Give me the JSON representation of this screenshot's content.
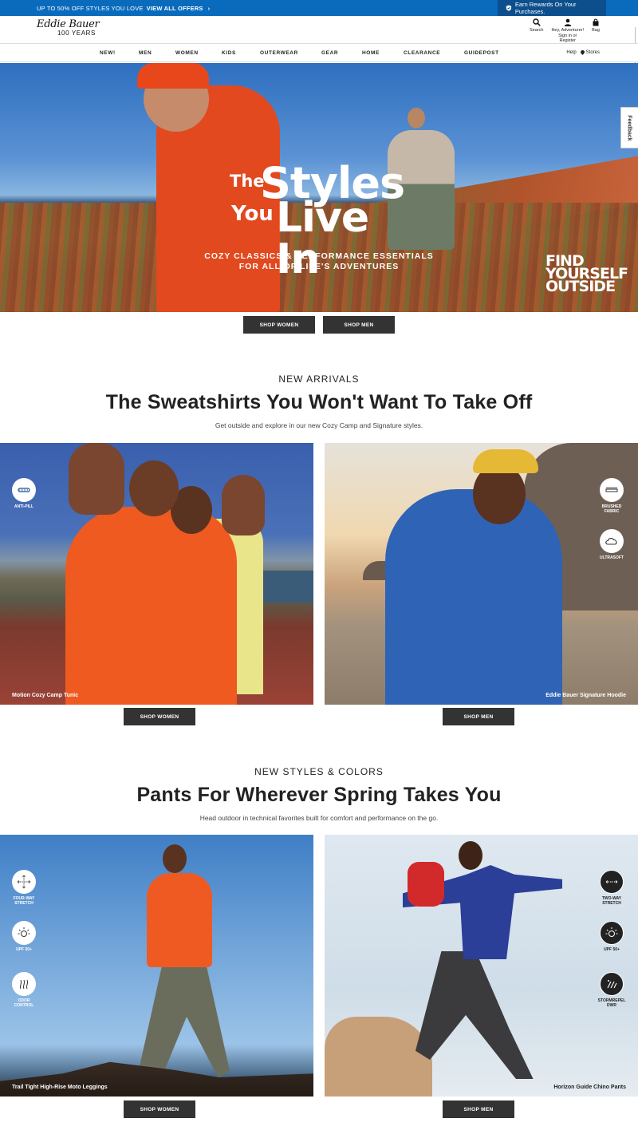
{
  "promo": {
    "text": "UP TO 50% OFF STYLES YOU LOVE",
    "link": "VIEW ALL OFFERS",
    "rewards": "Earn Rewards On Your Purchases."
  },
  "header": {
    "logo_script": "Eddie Bauer",
    "logo_years": "100 YEARS",
    "search": "Search",
    "account_line1": "Hey, Adventurer!",
    "account_line2": "Sign in or",
    "account_line3": "Register",
    "bag": "Bag"
  },
  "nav": {
    "items": [
      "NEW!",
      "MEN",
      "WOMEN",
      "KIDS",
      "OUTERWEAR",
      "GEAR",
      "HOME",
      "CLEARANCE",
      "GUIDEPOST"
    ],
    "help": "Help",
    "stores": "Stores"
  },
  "hero": {
    "title_the": "The",
    "title_styles": "Styles",
    "title_you": "You",
    "title_livein": "Live In",
    "sub1": "COZY CLASSICS & PERFORMANCE ESSENTIALS",
    "sub2": "FOR ALL OF LIFE'S ADVENTURES",
    "stamp1": "FIND",
    "stamp2": "YOURSELF",
    "stamp3": "OUTSIDE",
    "btn_women": "SHOP WOMEN",
    "btn_men": "SHOP MEN"
  },
  "feedback": "Feedback",
  "section1": {
    "eyebrow": "NEW ARRIVALS",
    "headline": "The Sweatshirts You Won't Want To Take Off",
    "subline": "Get outside and explore in our new Cozy Camp and Signature styles.",
    "left": {
      "caption": "Motion Cozy Camp Tunic",
      "badges": [
        {
          "label": "ANTI-PILL",
          "icon": "anti-pill-icon"
        }
      ],
      "button": "SHOP WOMEN"
    },
    "right": {
      "caption": "Eddie Bauer Signature Hoodie",
      "badges": [
        {
          "label": "BRUSHED FABRIC",
          "icon": "brushed-fabric-icon"
        },
        {
          "label": "ULTRASOFT",
          "icon": "ultrasoft-cloud-icon"
        }
      ],
      "button": "SHOP MEN"
    }
  },
  "section2": {
    "eyebrow": "NEW STYLES & COLORS",
    "headline": "Pants For Wherever Spring Takes You",
    "subline": "Head outdoor in technical favorites built for comfort and performance on the go.",
    "left": {
      "caption": "Trail Tight High-Rise Moto Leggings",
      "badges": [
        {
          "label": "FOUR-WAY STRETCH",
          "icon": "four-way-stretch-icon"
        },
        {
          "label": "UPF 50+",
          "icon": "sun-upf-icon"
        },
        {
          "label": "ODOR CONTROL",
          "icon": "odor-control-icon"
        }
      ],
      "button": "SHOP WOMEN"
    },
    "right": {
      "caption": "Horizon Guide Chino Pants",
      "badges": [
        {
          "label": "TWO-WAY STRETCH",
          "icon": "two-way-stretch-icon"
        },
        {
          "label": "UPF 50+",
          "icon": "sun-upf-icon"
        },
        {
          "label": "STORMREPEL DWR",
          "icon": "stormrepel-icon"
        }
      ],
      "button": "SHOP MEN"
    }
  },
  "colors": {
    "promo_blue": "#0a6bbd",
    "button_dark": "#333333"
  }
}
